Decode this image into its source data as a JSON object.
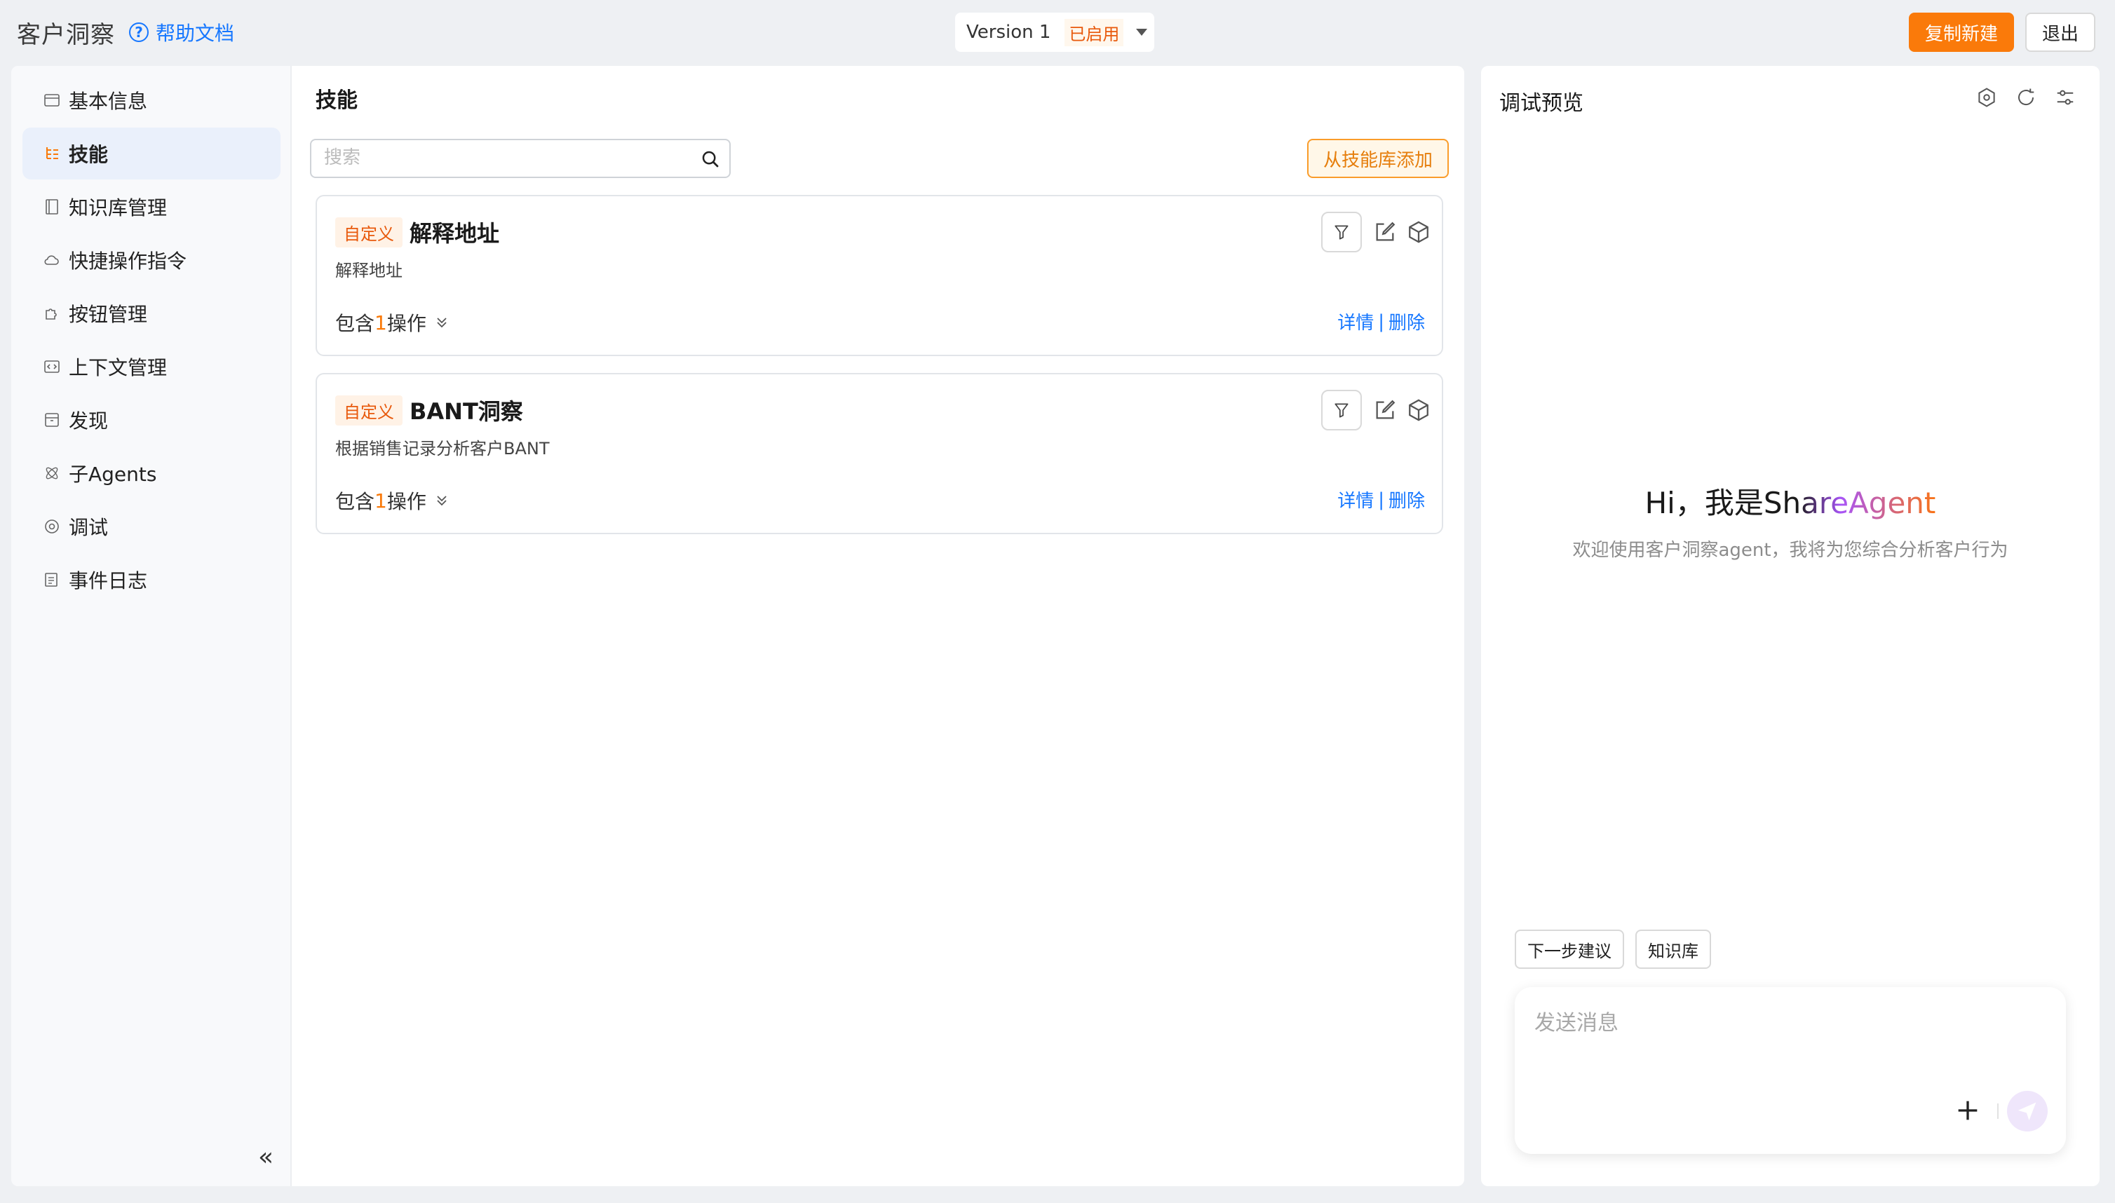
{
  "header": {
    "app_title": "客户洞察",
    "help_label": "帮助文档",
    "version_label": "Version 1",
    "version_status": "已启用",
    "copy_new_label": "复制新建",
    "exit_label": "退出"
  },
  "sidebar": {
    "items": [
      {
        "label": "基本信息",
        "icon": "info-card-icon"
      },
      {
        "label": "技能",
        "icon": "skills-tree-icon"
      },
      {
        "label": "知识库管理",
        "icon": "book-icon"
      },
      {
        "label": "快捷操作指令",
        "icon": "cloud-icon"
      },
      {
        "label": "按钮管理",
        "icon": "puzzle-icon"
      },
      {
        "label": "上下文管理",
        "icon": "code-icon"
      },
      {
        "label": "发现",
        "icon": "archive-icon"
      },
      {
        "label": "子Agents",
        "icon": "atom-icon"
      },
      {
        "label": "调试",
        "icon": "debug-icon"
      },
      {
        "label": "事件日志",
        "icon": "log-icon"
      }
    ],
    "active_index": 1,
    "collapse_glyph": "«"
  },
  "skills": {
    "title": "技能",
    "search_placeholder": "搜索",
    "add_from_library_label": "从技能库添加",
    "cards": [
      {
        "tag": "自定义",
        "name": "解释地址",
        "description": "解释地址",
        "ops_prefix": "包含",
        "ops_count": "1",
        "ops_suffix": "操作",
        "detail_label": "详情",
        "separator": "|",
        "delete_label": "删除"
      },
      {
        "tag": "自定义",
        "name": "BANT洞察",
        "description": "根据销售记录分析客户BANT",
        "ops_prefix": "包含",
        "ops_count": "1",
        "ops_suffix": "操作",
        "detail_label": "详情",
        "separator": "|",
        "delete_label": "删除"
      }
    ]
  },
  "preview": {
    "title": "调试预览",
    "greeting_prefix": "Hi，我是",
    "greeting_brand": "ShareAgent",
    "welcome": "欢迎使用客户洞察agent，我将为您综合分析客户行为",
    "chips": [
      "下一步建议",
      "知识库"
    ],
    "message_placeholder": "发送消息"
  },
  "colors": {
    "accent_orange": "#fa7a0a",
    "link_blue": "#1677ff",
    "active_bg": "#eaf0fb"
  }
}
